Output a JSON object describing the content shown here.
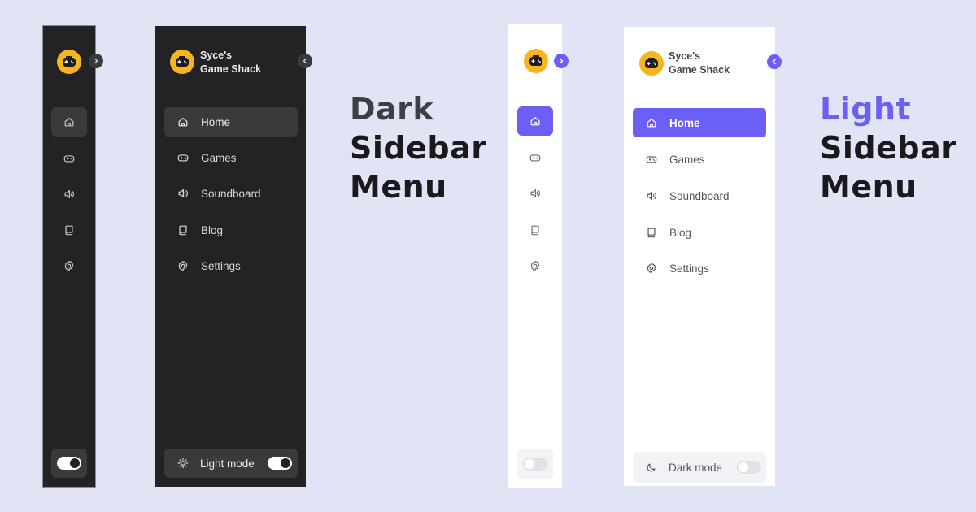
{
  "brand": {
    "name_line1": "Syce's",
    "name_line2": "Game Shack"
  },
  "menu": [
    {
      "label": "Home",
      "icon": "home-icon"
    },
    {
      "label": "Games",
      "icon": "gamepad-icon"
    },
    {
      "label": "Soundboard",
      "icon": "speaker-icon"
    },
    {
      "label": "Blog",
      "icon": "book-icon"
    },
    {
      "label": "Settings",
      "icon": "gear-icon"
    }
  ],
  "active_item": "Home",
  "dark_panel": {
    "mode_label": "Light mode",
    "switch_on": true
  },
  "light_panel": {
    "mode_label": "Dark mode",
    "switch_on": false
  },
  "captions": {
    "dark": {
      "line1": "Dark",
      "line2": "Sidebar",
      "line3": "Menu"
    },
    "light": {
      "line1": "Light",
      "line2": "Sidebar",
      "line3": "Menu"
    }
  },
  "colors": {
    "page_bg": "#e0e4f5",
    "dark_bg": "#232325",
    "dark_active": "#3a3a3c",
    "accent": "#6c5ff5",
    "avatar": "#f6b51e"
  }
}
